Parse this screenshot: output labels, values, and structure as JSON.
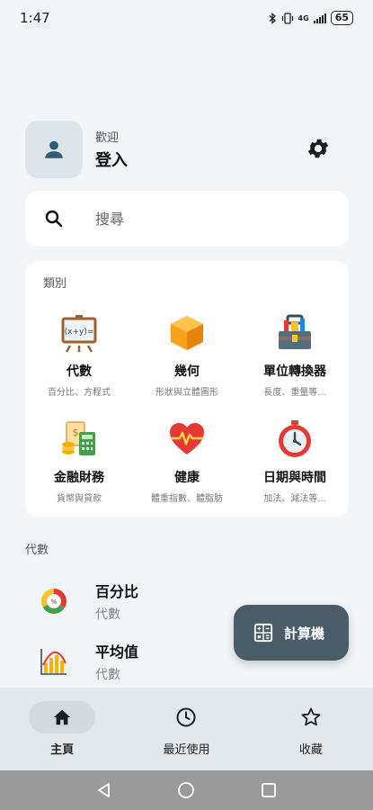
{
  "status_bar": {
    "time": "1:47",
    "network": "4G",
    "battery": "65"
  },
  "profile": {
    "welcome": "歡迎",
    "login": "登入"
  },
  "search": {
    "placeholder": "搜尋"
  },
  "categories": {
    "title": "類別",
    "items": [
      {
        "name": "代數",
        "sub": "百分比、方程式",
        "icon": "easel-algebra-icon"
      },
      {
        "name": "幾何",
        "sub": "形狀與立體圖形",
        "icon": "cube-icon"
      },
      {
        "name": "單位轉換器",
        "sub": "長度、重量等...",
        "icon": "toolbox-icon"
      },
      {
        "name": "金融財務",
        "sub": "貨幣與貸款",
        "icon": "finance-icon"
      },
      {
        "name": "健康",
        "sub": "體重指數、體脂肪",
        "icon": "heart-icon"
      },
      {
        "name": "日期與時間",
        "sub": "加法、減法等...",
        "icon": "stopwatch-icon"
      }
    ]
  },
  "section": {
    "title": "代數",
    "items": [
      {
        "title": "百分比",
        "sub": "代數",
        "icon": "percent-ring-icon"
      },
      {
        "title": "平均值",
        "sub": "代數",
        "icon": "bar-chart-icon"
      }
    ]
  },
  "fab": {
    "label": "計算機"
  },
  "bottom_nav": {
    "items": [
      {
        "label": "主頁",
        "active": true
      },
      {
        "label": "最近使用",
        "active": false
      },
      {
        "label": "收藏",
        "active": false
      }
    ]
  },
  "colors": {
    "background": "#f2f5f8",
    "fab": "#495c68",
    "avatar_accent": "#2f5d73",
    "nav_bar": "#e3e8ec"
  }
}
